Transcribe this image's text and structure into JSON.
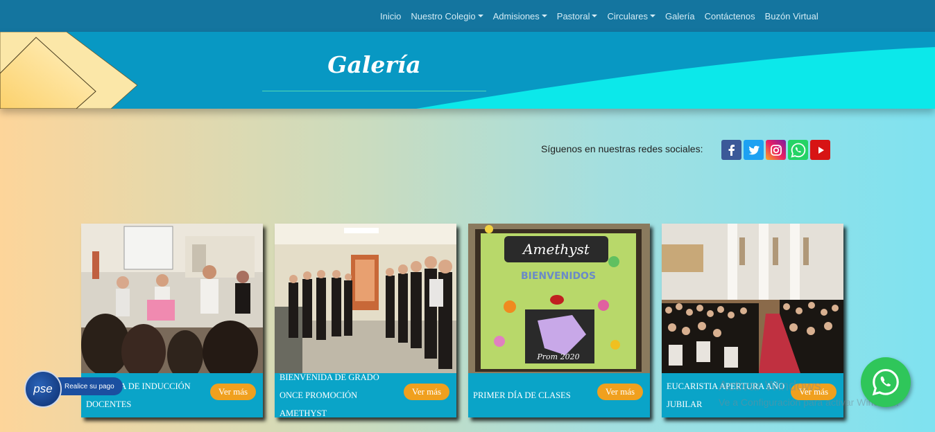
{
  "nav": {
    "items": [
      {
        "label": "Inicio",
        "dropdown": false
      },
      {
        "label": "Nuestro Colegio",
        "dropdown": true
      },
      {
        "label": "Admisiones",
        "dropdown": true
      },
      {
        "label": "Pastoral",
        "dropdown": true
      },
      {
        "label": "Circulares",
        "dropdown": true
      },
      {
        "label": "Galería",
        "dropdown": false
      },
      {
        "label": "Contáctenos",
        "dropdown": false
      },
      {
        "label": "Buzón Virtual",
        "dropdown": false
      }
    ]
  },
  "banner": {
    "title": "Galería"
  },
  "social": {
    "label": "Síguenos en nuestras redes sociales:",
    "icons": [
      "facebook-icon",
      "twitter-icon",
      "instagram-icon",
      "whatsapp-icon",
      "youtube-icon"
    ]
  },
  "gallery": {
    "cards": [
      {
        "title": "JORNADA DE INDUCCIÓN DOCENTES",
        "button": "Ver más"
      },
      {
        "title": "BIENVENIDA DE GRADO ONCE PROMOCIÓN AMETHYST",
        "button": "Ver más"
      },
      {
        "title": "PRIMER DÍA DE CLASES",
        "button": "Ver más"
      },
      {
        "title": "EUCARISTIA APERTURA AÑO JUBILAR",
        "button": "Ver más"
      }
    ],
    "poster_text": {
      "line1": "Amethyst",
      "line2": "BIENVENIDOS",
      "line3": "Prom 2020"
    }
  },
  "pse": {
    "logo": "pse",
    "label": "Realice su pago"
  },
  "watermark": {
    "line1": "Activar Windows",
    "line2": "Ve a Configuración para activar Windows."
  },
  "colors": {
    "navbar": "#14759f",
    "banner": "#0898c3",
    "caption": "#0aa4c8",
    "button": "#f0a01e",
    "whatsapp": "#2fc65a"
  }
}
